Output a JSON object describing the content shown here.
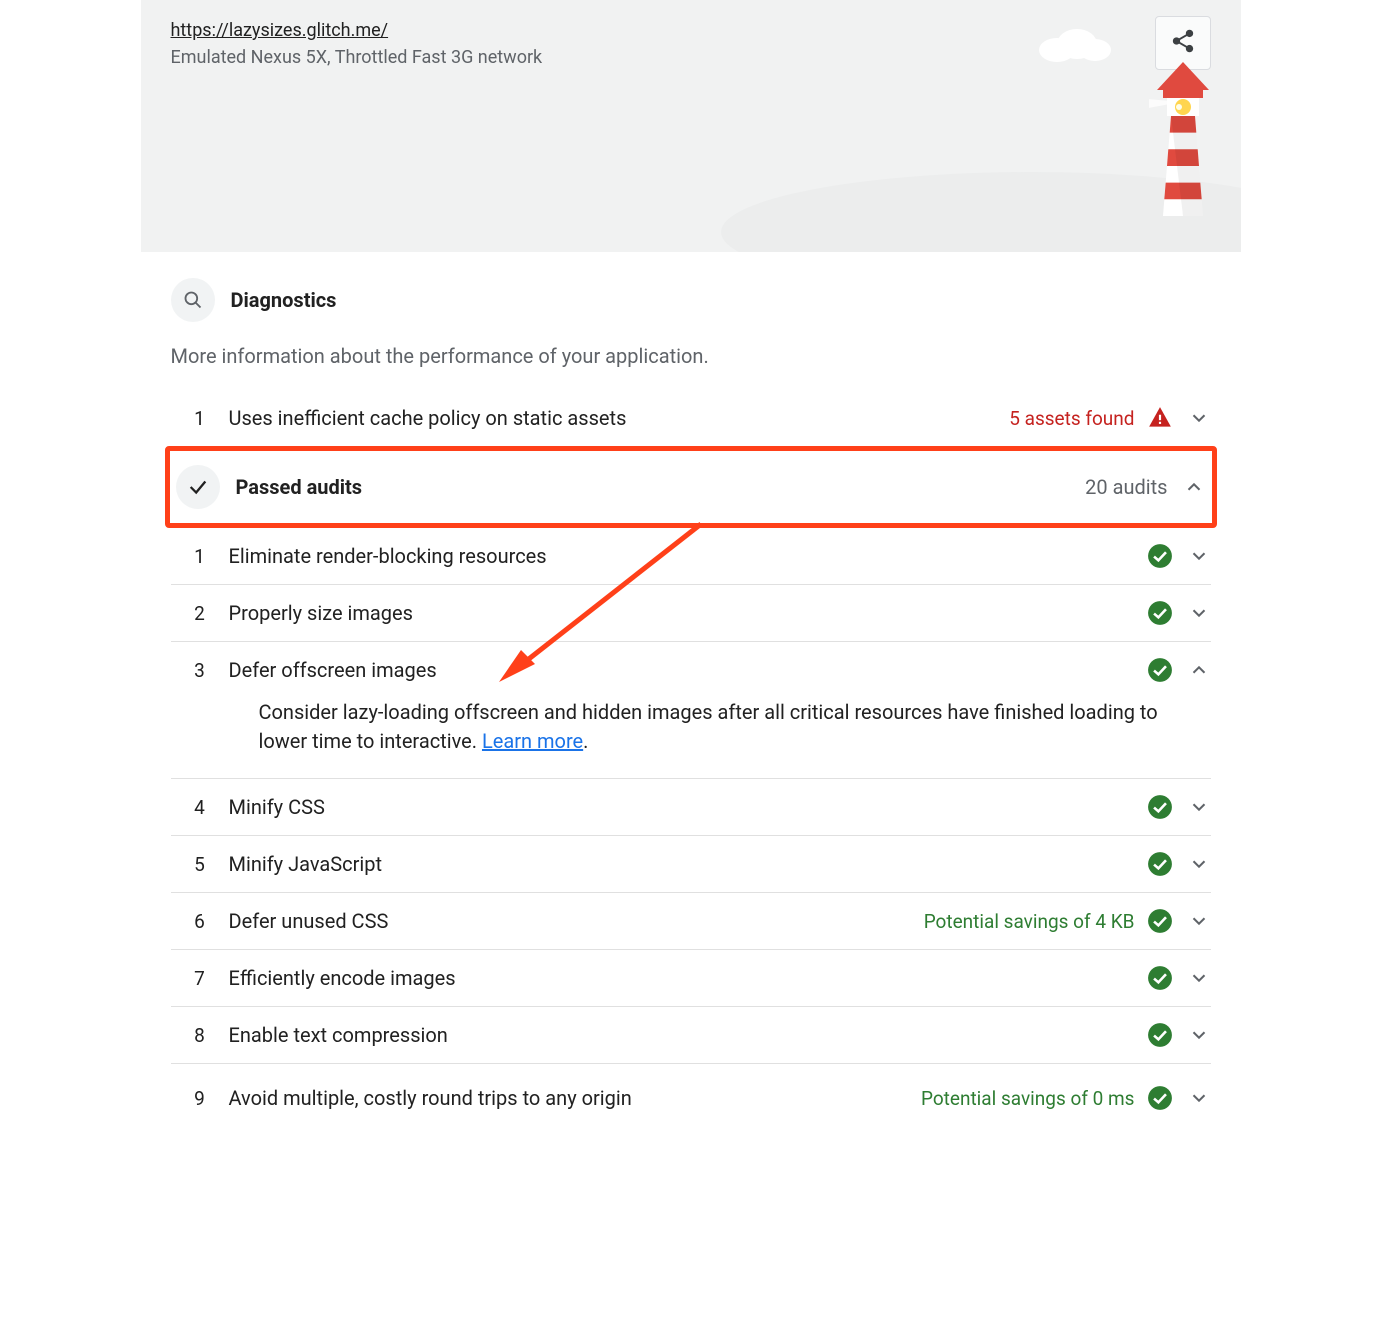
{
  "header": {
    "url": "https://lazysizes.glitch.me/",
    "subtitle": "Emulated Nexus 5X, Throttled Fast 3G network"
  },
  "diagnostics": {
    "title": "Diagnostics",
    "description": "More information about the performance of your application.",
    "items": [
      {
        "num": "1",
        "title": "Uses inefficient cache policy on static assets",
        "meta": "5 assets found",
        "meta_class": "meta-red",
        "status": "warn",
        "expanded": false
      }
    ]
  },
  "passed": {
    "title": "Passed audits",
    "summary": "20 audits",
    "items": [
      {
        "num": "1",
        "title": "Eliminate render-blocking resources",
        "meta": "",
        "status": "pass",
        "expanded": false
      },
      {
        "num": "2",
        "title": "Properly size images",
        "meta": "",
        "status": "pass",
        "expanded": false
      },
      {
        "num": "3",
        "title": "Defer offscreen images",
        "meta": "",
        "status": "pass",
        "expanded": true,
        "detail": "Consider lazy-loading offscreen and hidden images after all critical resources have finished loading to lower time to interactive. ",
        "learn": "Learn more"
      },
      {
        "num": "4",
        "title": "Minify CSS",
        "meta": "",
        "status": "pass",
        "expanded": false
      },
      {
        "num": "5",
        "title": "Minify JavaScript",
        "meta": "",
        "status": "pass",
        "expanded": false
      },
      {
        "num": "6",
        "title": "Defer unused CSS",
        "meta": "Potential savings of 4 KB",
        "meta_class": "meta-green",
        "status": "pass",
        "expanded": false
      },
      {
        "num": "7",
        "title": "Efficiently encode images",
        "meta": "",
        "status": "pass",
        "expanded": false
      },
      {
        "num": "8",
        "title": "Enable text compression",
        "meta": "",
        "status": "pass",
        "expanded": false
      },
      {
        "num": "9",
        "title": "Avoid multiple, costly round trips to any origin",
        "meta": "Potential savings of 0 ms",
        "meta_class": "meta-green",
        "status": "pass",
        "expanded": false
      }
    ]
  }
}
